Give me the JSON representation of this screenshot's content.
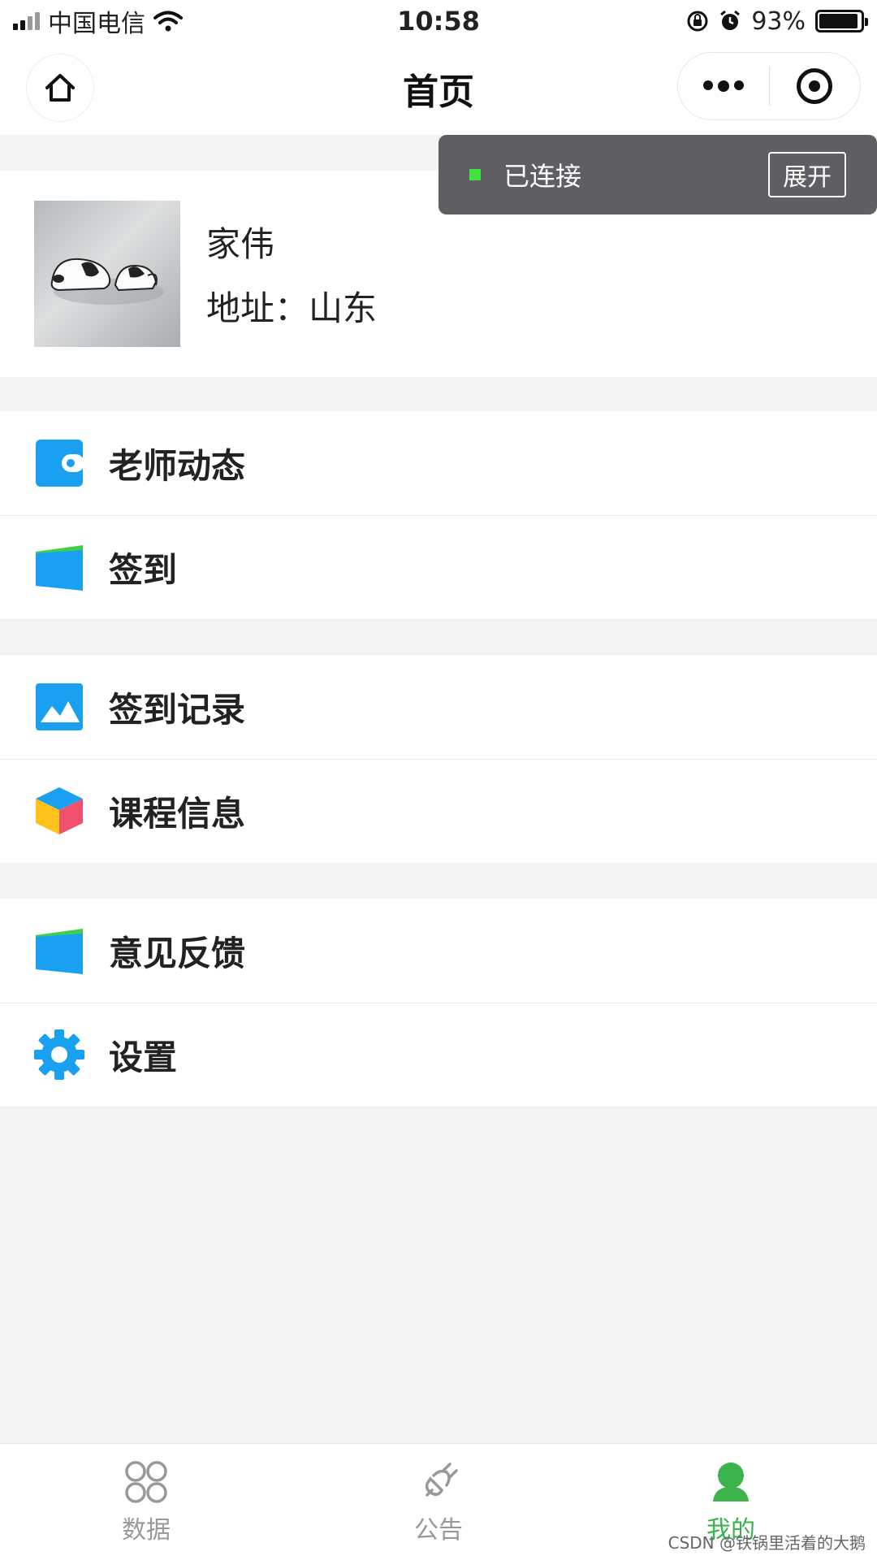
{
  "status_bar": {
    "carrier": "中国电信",
    "time": "10:58",
    "battery": "93%",
    "battery_level": 0.93
  },
  "nav": {
    "title": "首页"
  },
  "toast": {
    "text": "已连接",
    "button": "展开"
  },
  "profile": {
    "name": "家伟",
    "address": "地址：山东"
  },
  "menu_groups": [
    [
      {
        "label": "老师动态",
        "icon": "wallet-icon"
      },
      {
        "label": "签到",
        "icon": "folder-icon"
      }
    ],
    [
      {
        "label": "签到记录",
        "icon": "image-icon"
      },
      {
        "label": "课程信息",
        "icon": "cube-icon"
      }
    ],
    [
      {
        "label": "意见反馈",
        "icon": "folder-icon"
      },
      {
        "label": "设置",
        "icon": "gear-icon"
      }
    ]
  ],
  "tabs": [
    {
      "label": "数据",
      "icon": "grid-circles-icon"
    },
    {
      "label": "公告",
      "icon": "plug-icon"
    },
    {
      "label": "我的",
      "icon": "person-icon",
      "active": true
    }
  ],
  "watermark": "CSDN @铁锅里活着的大鹅",
  "colors": {
    "accent_blue": "#1aa0f0",
    "active_green": "#3bb34a",
    "toast_bg": "#5f5f63",
    "connected_green": "#3fe23f"
  }
}
